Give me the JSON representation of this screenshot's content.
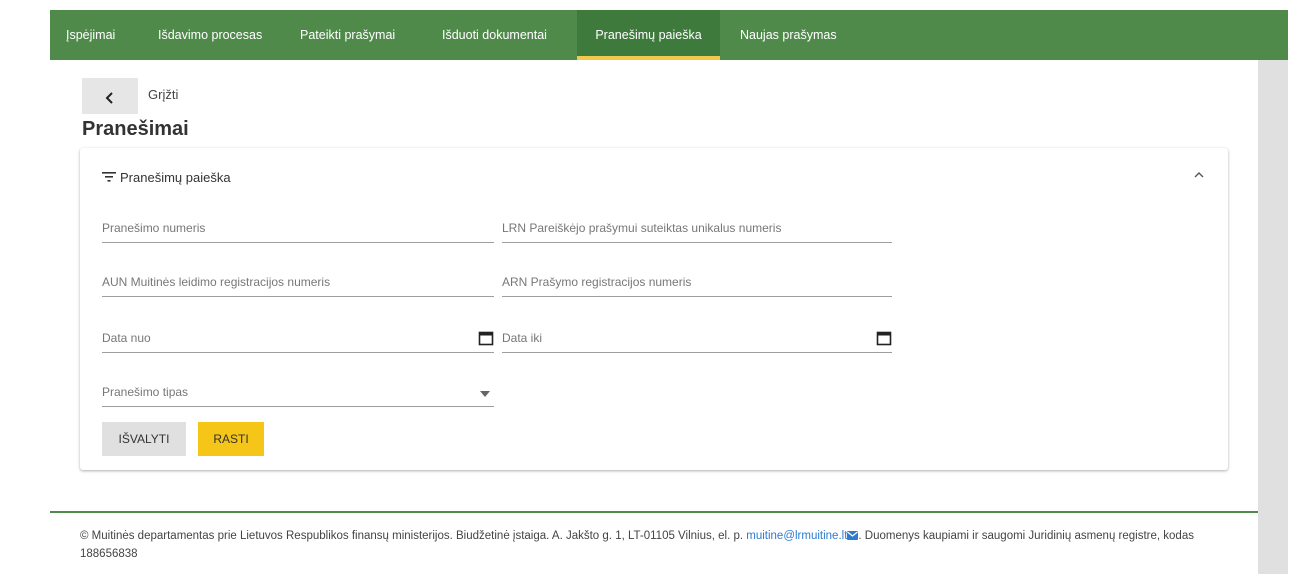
{
  "nav": {
    "tabs": [
      {
        "label": "Įspėjimai"
      },
      {
        "label": "Išdavimo procesas"
      },
      {
        "label": "Pateikti prašymai"
      },
      {
        "label": "Išduoti dokumentai"
      },
      {
        "label": "Pranešimų paieška",
        "active": true
      },
      {
        "label": "Naujas prašymas"
      }
    ]
  },
  "back": {
    "icon": "chevron-left-icon",
    "label": "Grįžti"
  },
  "page": {
    "title": "Pranešimai"
  },
  "search_panel": {
    "title": "Pranešimų paieška",
    "filter_icon": "filter-icon",
    "collapse_icon": "chevron-up-icon",
    "fields": {
      "message_number": "Pranešimo numeris",
      "lrn": "LRN Pareiškėjo prašymui suteiktas unikalus numeris",
      "aun": "AUN Muitinės leidimo registracijos numeris",
      "arn": "ARN Prašymo registracijos numeris",
      "date_from": "Data nuo",
      "date_to": "Data iki",
      "message_type": "Pranešimo tipas"
    },
    "buttons": {
      "clear": "IŠVALYTI",
      "find": "RASTI"
    }
  },
  "footer": {
    "text_before": "© Muitinės departamentas prie Lietuvos Respublikos finansų ministerijos. Biudžetinė įstaiga. A. Jakšto g. 1, LT-01105 Vilnius, el. p. ",
    "email": "muitine@lrmuitine.lt",
    "text_after": ". Duomenys kaupiami ir saugomi Juridinių asmenų registre, kodas 188656838"
  },
  "colors": {
    "nav_bg": "#4f8a4b",
    "active_underline": "#f2c94c",
    "find_button": "#f5c518",
    "link": "#2f7bd1"
  }
}
